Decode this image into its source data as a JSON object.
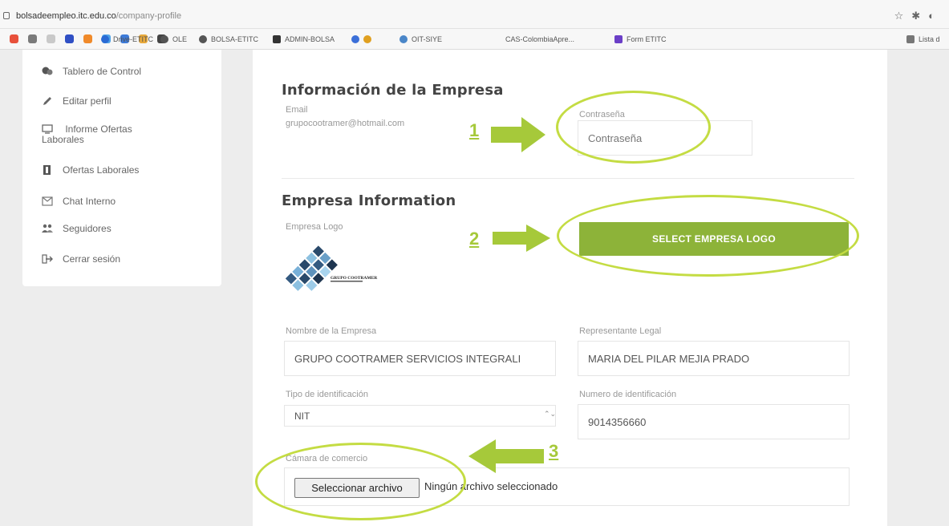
{
  "browser": {
    "url_host": "bolsadeempleo.itc.edu.co",
    "url_path": "/company-profile",
    "bookmarks": [
      "Drive-ETITC",
      "OLE",
      "BOLSA-ETITC",
      "ADMIN-BOLSA",
      "OIT-SIYE",
      "CAS-ColombiaApre...",
      "Form ETITC",
      "Lista d"
    ]
  },
  "sidebar": {
    "items": [
      {
        "label": "Tablero de Control",
        "icon": "dashboard-icon"
      },
      {
        "label": "Editar perfil",
        "icon": "pencil-icon"
      },
      {
        "label": "Informe Ofertas Laborales",
        "icon": "monitor-icon"
      },
      {
        "label": "Ofertas Laborales",
        "icon": "briefcase-icon"
      },
      {
        "label": "Chat Interno",
        "icon": "envelope-icon"
      },
      {
        "label": "Seguidores",
        "icon": "users-icon"
      },
      {
        "label": "Cerrar sesión",
        "icon": "logout-icon"
      }
    ]
  },
  "company_info": {
    "title": "Información de la Empresa",
    "email_label": "Email",
    "email_value": "grupocootramer@hotmail.com",
    "password_label": "Contraseña",
    "password_placeholder": "Contraseña"
  },
  "empresa_info": {
    "title": "Empresa Information",
    "logo_label": "Empresa Logo",
    "logo_text": "GRUPO COOTRAMER",
    "select_logo_button": "SELECT EMPRESA LOGO",
    "company_name_label": "Nombre de la Empresa",
    "company_name_value": "GRUPO COOTRAMER SERVICIOS INTEGRALI",
    "legal_rep_label": "Representante Legal",
    "legal_rep_value": "MARIA DEL PILAR MEJIA PRADO",
    "id_type_label": "Tipo de identificación",
    "id_type_value": "NIT",
    "id_number_label": "Numero de identificación",
    "id_number_value": "9014356660",
    "chamber_label": "Cámara de comercio",
    "file_button": "Seleccionar archivo",
    "file_status": "Ningún archivo seleccionado"
  },
  "annotations": {
    "step1": "1",
    "step2": "2",
    "step3": "3",
    "color": "#a6c93a"
  },
  "colors": {
    "accent": "#8db339",
    "highlight": "#c4dc43"
  }
}
